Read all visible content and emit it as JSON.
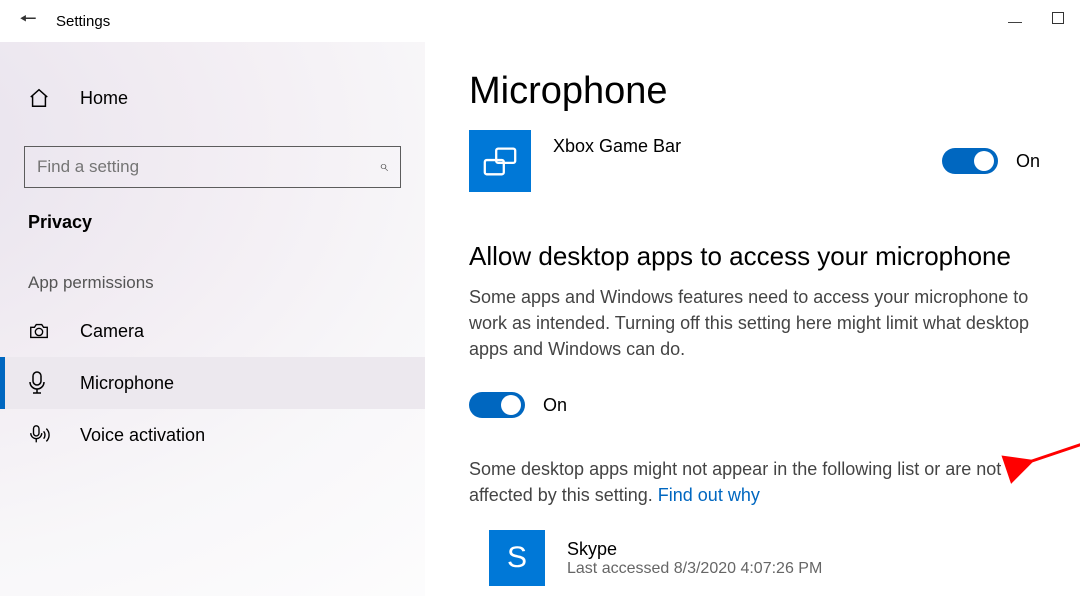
{
  "titlebar": {
    "title": "Settings"
  },
  "sidebar": {
    "home_label": "Home",
    "search_placeholder": "Find a setting",
    "section_privacy": "Privacy",
    "section_app_permissions": "App permissions",
    "items": [
      {
        "label": "Camera"
      },
      {
        "label": "Microphone"
      },
      {
        "label": "Voice activation"
      }
    ]
  },
  "content": {
    "page_title": "Microphone",
    "xbox": {
      "label": "Xbox Game Bar",
      "state": "On"
    },
    "allow_desktop": {
      "heading": "Allow desktop apps to access your microphone",
      "body": "Some apps and Windows features need to access your microphone to work as intended. Turning off this setting here might limit what desktop apps and Windows can do.",
      "state": "On",
      "note_pre": "Some desktop apps might not appear in the following list or are not affected by this setting. ",
      "note_link": "Find out why"
    },
    "skype": {
      "name": "Skype",
      "last_accessed": "Last accessed 8/3/2020 4:07:26 PM"
    }
  }
}
